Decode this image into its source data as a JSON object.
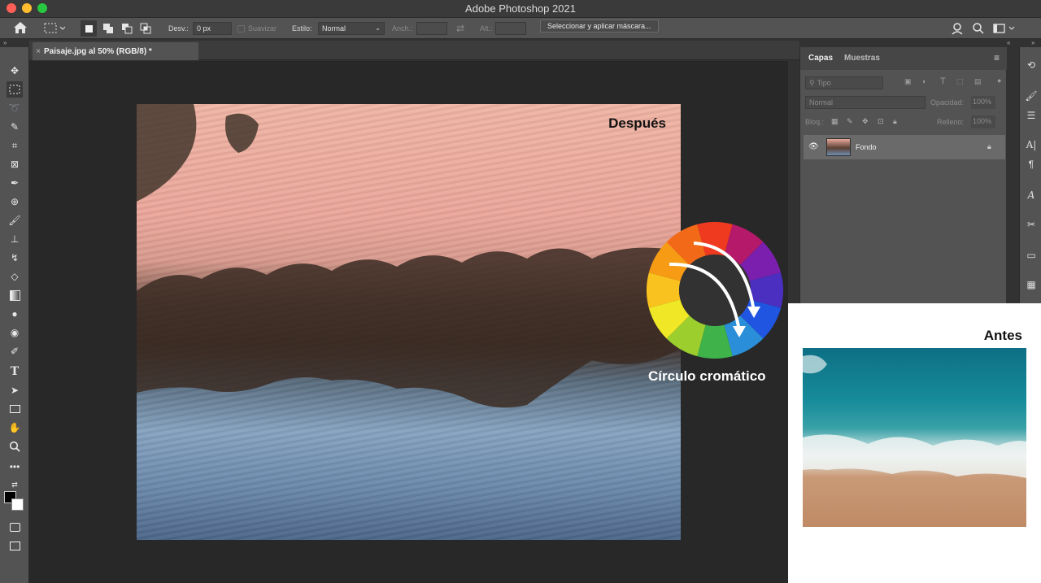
{
  "window": {
    "title": "Adobe Photoshop 2021"
  },
  "options_bar": {
    "feather_label": "Desv.:",
    "feather_value": "0 px",
    "antialias_label": "Suavizar",
    "style_label": "Estilo:",
    "style_value": "Normal",
    "width_label": "Anch.:",
    "height_label": "Alt.:",
    "select_mask_button": "Seleccionar y aplicar máscara..."
  },
  "document": {
    "tab_title": "Paisaje.jpg al 50% (RGB/8) *"
  },
  "canvas": {
    "after_label": "Después"
  },
  "panels": {
    "tabs": [
      "Capas",
      "Muestras"
    ],
    "filter_placeholder": "Tipo",
    "blend_mode": "Normal",
    "opacity_label": "Opacidad:",
    "opacity_value": "100%",
    "lock_label": "Bloq.:",
    "fill_label": "Relleno:",
    "fill_value": "100%",
    "layers": [
      {
        "name": "Fondo",
        "locked": true,
        "visible": true
      }
    ]
  },
  "overlay": {
    "before_label": "Antes",
    "color_wheel_label": "Círculo cromático"
  },
  "colors": {
    "wheel": [
      "#f03a1f",
      "#b5196a",
      "#7a1fae",
      "#4a2fc0",
      "#1f55e0",
      "#2a8fd8",
      "#3fb24a",
      "#9ccf2e",
      "#f0e826",
      "#f9c21f",
      "#f79b14",
      "#f26a18"
    ]
  }
}
